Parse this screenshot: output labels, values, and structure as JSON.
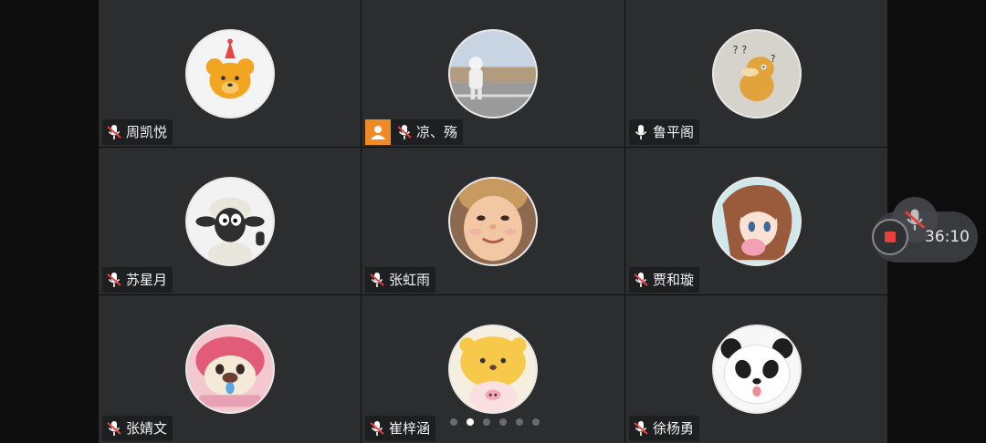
{
  "participants": [
    {
      "name": "周凯悦",
      "avatar": "bear-party-hat",
      "muted": true,
      "host": false
    },
    {
      "name": "凉、殇",
      "avatar": "astronaut-desert",
      "muted": true,
      "host": true
    },
    {
      "name": "鲁平阁",
      "avatar": "psyduck-confused",
      "muted": false,
      "host": false
    },
    {
      "name": "苏星月",
      "avatar": "shaun-the-sheep",
      "muted": true,
      "host": false
    },
    {
      "name": "张虹雨",
      "avatar": "child-face",
      "muted": true,
      "host": false
    },
    {
      "name": "贾和璇",
      "avatar": "anime-girl",
      "muted": true,
      "host": false
    },
    {
      "name": "张婧文",
      "avatar": "pink-bear-plush",
      "muted": true,
      "host": false
    },
    {
      "name": "崔梓涵",
      "avatar": "yellow-bear-pig",
      "muted": true,
      "host": false
    },
    {
      "name": "徐杨勇",
      "avatar": "panda-tongue",
      "muted": true,
      "host": false
    }
  ],
  "pager": {
    "pages": 6,
    "current": 2
  },
  "call": {
    "timer": "36:10"
  },
  "colors": {
    "tile_bg": "#2c2d2f",
    "host_badge": "#f08a24",
    "mute_red": "#e8413b"
  }
}
